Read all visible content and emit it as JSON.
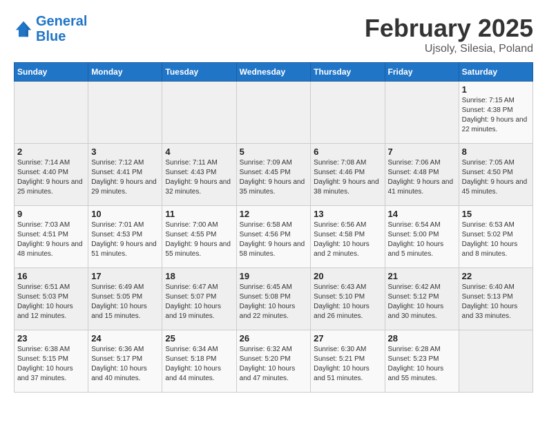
{
  "header": {
    "logo_line1": "General",
    "logo_line2": "Blue",
    "month": "February 2025",
    "location": "Ujsoly, Silesia, Poland"
  },
  "weekdays": [
    "Sunday",
    "Monday",
    "Tuesday",
    "Wednesday",
    "Thursday",
    "Friday",
    "Saturday"
  ],
  "weeks": [
    [
      {
        "day": "",
        "info": ""
      },
      {
        "day": "",
        "info": ""
      },
      {
        "day": "",
        "info": ""
      },
      {
        "day": "",
        "info": ""
      },
      {
        "day": "",
        "info": ""
      },
      {
        "day": "",
        "info": ""
      },
      {
        "day": "1",
        "info": "Sunrise: 7:15 AM\nSunset: 4:38 PM\nDaylight: 9 hours and 22 minutes."
      }
    ],
    [
      {
        "day": "2",
        "info": "Sunrise: 7:14 AM\nSunset: 4:40 PM\nDaylight: 9 hours and 25 minutes."
      },
      {
        "day": "3",
        "info": "Sunrise: 7:12 AM\nSunset: 4:41 PM\nDaylight: 9 hours and 29 minutes."
      },
      {
        "day": "4",
        "info": "Sunrise: 7:11 AM\nSunset: 4:43 PM\nDaylight: 9 hours and 32 minutes."
      },
      {
        "day": "5",
        "info": "Sunrise: 7:09 AM\nSunset: 4:45 PM\nDaylight: 9 hours and 35 minutes."
      },
      {
        "day": "6",
        "info": "Sunrise: 7:08 AM\nSunset: 4:46 PM\nDaylight: 9 hours and 38 minutes."
      },
      {
        "day": "7",
        "info": "Sunrise: 7:06 AM\nSunset: 4:48 PM\nDaylight: 9 hours and 41 minutes."
      },
      {
        "day": "8",
        "info": "Sunrise: 7:05 AM\nSunset: 4:50 PM\nDaylight: 9 hours and 45 minutes."
      }
    ],
    [
      {
        "day": "9",
        "info": "Sunrise: 7:03 AM\nSunset: 4:51 PM\nDaylight: 9 hours and 48 minutes."
      },
      {
        "day": "10",
        "info": "Sunrise: 7:01 AM\nSunset: 4:53 PM\nDaylight: 9 hours and 51 minutes."
      },
      {
        "day": "11",
        "info": "Sunrise: 7:00 AM\nSunset: 4:55 PM\nDaylight: 9 hours and 55 minutes."
      },
      {
        "day": "12",
        "info": "Sunrise: 6:58 AM\nSunset: 4:56 PM\nDaylight: 9 hours and 58 minutes."
      },
      {
        "day": "13",
        "info": "Sunrise: 6:56 AM\nSunset: 4:58 PM\nDaylight: 10 hours and 2 minutes."
      },
      {
        "day": "14",
        "info": "Sunrise: 6:54 AM\nSunset: 5:00 PM\nDaylight: 10 hours and 5 minutes."
      },
      {
        "day": "15",
        "info": "Sunrise: 6:53 AM\nSunset: 5:02 PM\nDaylight: 10 hours and 8 minutes."
      }
    ],
    [
      {
        "day": "16",
        "info": "Sunrise: 6:51 AM\nSunset: 5:03 PM\nDaylight: 10 hours and 12 minutes."
      },
      {
        "day": "17",
        "info": "Sunrise: 6:49 AM\nSunset: 5:05 PM\nDaylight: 10 hours and 15 minutes."
      },
      {
        "day": "18",
        "info": "Sunrise: 6:47 AM\nSunset: 5:07 PM\nDaylight: 10 hours and 19 minutes."
      },
      {
        "day": "19",
        "info": "Sunrise: 6:45 AM\nSunset: 5:08 PM\nDaylight: 10 hours and 22 minutes."
      },
      {
        "day": "20",
        "info": "Sunrise: 6:43 AM\nSunset: 5:10 PM\nDaylight: 10 hours and 26 minutes."
      },
      {
        "day": "21",
        "info": "Sunrise: 6:42 AM\nSunset: 5:12 PM\nDaylight: 10 hours and 30 minutes."
      },
      {
        "day": "22",
        "info": "Sunrise: 6:40 AM\nSunset: 5:13 PM\nDaylight: 10 hours and 33 minutes."
      }
    ],
    [
      {
        "day": "23",
        "info": "Sunrise: 6:38 AM\nSunset: 5:15 PM\nDaylight: 10 hours and 37 minutes."
      },
      {
        "day": "24",
        "info": "Sunrise: 6:36 AM\nSunset: 5:17 PM\nDaylight: 10 hours and 40 minutes."
      },
      {
        "day": "25",
        "info": "Sunrise: 6:34 AM\nSunset: 5:18 PM\nDaylight: 10 hours and 44 minutes."
      },
      {
        "day": "26",
        "info": "Sunrise: 6:32 AM\nSunset: 5:20 PM\nDaylight: 10 hours and 47 minutes."
      },
      {
        "day": "27",
        "info": "Sunrise: 6:30 AM\nSunset: 5:21 PM\nDaylight: 10 hours and 51 minutes."
      },
      {
        "day": "28",
        "info": "Sunrise: 6:28 AM\nSunset: 5:23 PM\nDaylight: 10 hours and 55 minutes."
      },
      {
        "day": "",
        "info": ""
      }
    ]
  ]
}
